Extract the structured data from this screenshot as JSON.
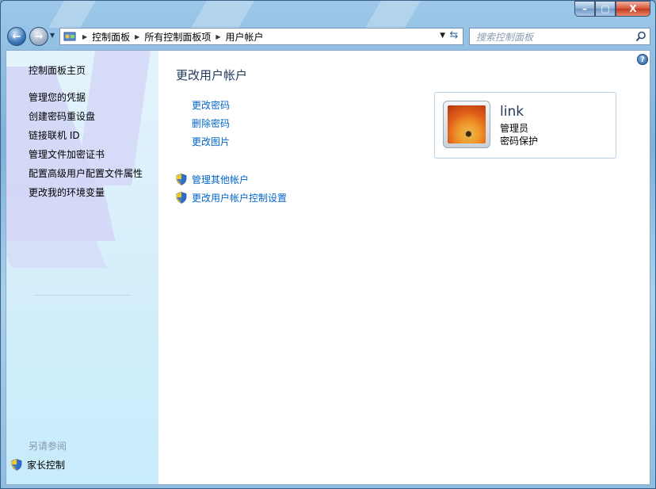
{
  "window": {
    "caption": {
      "min": "–",
      "max": "□",
      "close": "X"
    }
  },
  "toolbar": {
    "breadcrumb": [
      "控制面板",
      "所有控制面板项",
      "用户帐户"
    ],
    "search_placeholder": "搜索控制面板"
  },
  "sidebar": {
    "home": "控制面板主页",
    "links": [
      "管理您的凭据",
      "创建密码重设盘",
      "链接联机 ID",
      "管理文件加密证书",
      "配置高级用户配置文件属性",
      "更改我的环境变量"
    ],
    "see_also": "另请参阅",
    "parental": "家长控制"
  },
  "main": {
    "title": "更改用户帐户",
    "tasks": [
      "更改密码",
      "删除密码",
      "更改图片"
    ],
    "shield_tasks": [
      "管理其他帐户",
      "更改用户帐户控制设置"
    ],
    "user": {
      "name": "link",
      "role": "管理员",
      "status": "密码保护"
    }
  },
  "colors": {
    "link": "#0066cc",
    "title": "#1e395b",
    "sidebar_bg": "#d6effb"
  }
}
